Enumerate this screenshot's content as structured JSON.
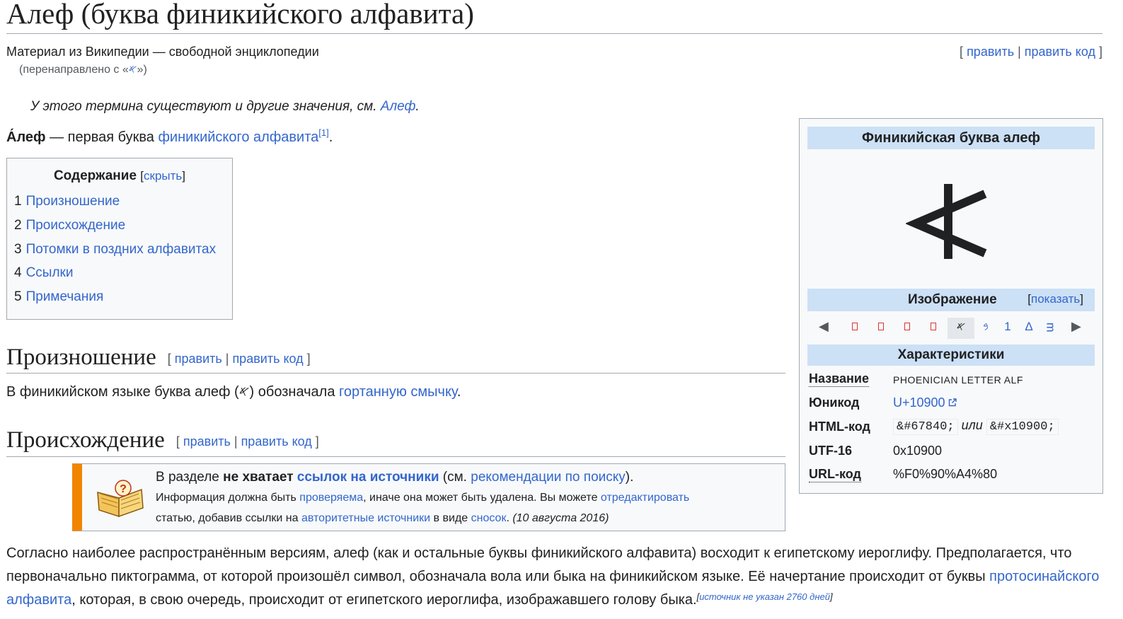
{
  "article": {
    "title": "Алеф (буква финикийского алфавита)",
    "site_sub": "Материал из Википедии — свободной энциклопедии",
    "redirect_prefix": "(перенаправлено с «",
    "redirect_glyph": "𐤀",
    "redirect_suffix": "»)",
    "edit_label": "править",
    "edit_source_label": "править код"
  },
  "hatnote": {
    "text": "У этого термина существуют и другие значения, см. ",
    "link": "Алеф",
    "end": "."
  },
  "lead": {
    "bold": "А́леф",
    "text": " — первая буква ",
    "link": "финикийского алфавита",
    "ref": "[1]",
    "end": "."
  },
  "toc": {
    "title": "Содержание",
    "toggle": "скрыть",
    "items": [
      {
        "num": "1",
        "label": "Произношение"
      },
      {
        "num": "2",
        "label": "Происхождение"
      },
      {
        "num": "3",
        "label": "Потомки в поздних алфавитах"
      },
      {
        "num": "4",
        "label": "Ссылки"
      },
      {
        "num": "5",
        "label": "Примечания"
      }
    ]
  },
  "sections": {
    "pronunciation": {
      "heading": "Произношение",
      "text_before": "В финикийском языке буква алеф (",
      "glyph": "𐤀",
      "text_middle": ") обозначала ",
      "link": "гортанную смычку",
      "end": "."
    },
    "origin": {
      "heading": "Происхождение"
    }
  },
  "ambox": {
    "l1_a": "В разделе ",
    "l1_bold": "не хватает ",
    "l1_link_bold": "ссылок на источники",
    "l1_b": " (см. ",
    "l1_link": "рекомендации по поиску",
    "l1_c": ").",
    "l2_a": "Информация должна быть ",
    "l2_link1": "проверяема",
    "l2_b": ", иначе она может быть удалена. Вы можете ",
    "l2_link2": "отредактировать",
    "l3_a": "статью, добавив ссылки на ",
    "l3_link1": "авторитетные источники",
    "l3_b": " в виде ",
    "l3_link2": "сносок",
    "l3_c": ". ",
    "l3_date": "(10 августа 2016)"
  },
  "bottom": {
    "text1": "Согласно наиболее распространённым версиям, алеф (как и остальные буквы финикийского алфавита) восходит к египетскому иероглифу. Предполагается, что первоначально пиктограмма, от которой произошёл символ, обозначала вола или быка на финикийском языке. Её начертание происходит от буквы ",
    "link": "протосинайского алфавита",
    "text2": ", которая, в свою очередь, происходит от египетского иероглифа, изображавшего голову быка.",
    "cite_open": "[",
    "cite_text": "источник не указан 2760 дней",
    "cite_close": "]"
  },
  "infobox": {
    "title": "Финикийская буква алеф",
    "image_label": "Изображение",
    "image_toggle": "показать",
    "nav": {
      "prev": "◀",
      "next": "▶",
      "glyphs": [
        "𐤀",
        "𐤁",
        "1",
        "Δ",
        "ᴟ"
      ]
    },
    "char_header": "Характеристики",
    "rows": {
      "name_label": "Название",
      "name_value": "PHOENICIAN LETTER ALF",
      "unicode_label": "Юникод",
      "unicode_value": "U+10900",
      "html_label": "HTML-код",
      "html_dec": "&#67840;",
      "html_or": "или",
      "html_hex": "&#x10900;",
      "utf16_label": "UTF-16",
      "utf16_value": "0x10900",
      "url_label": "URL-код",
      "url_value": "%F0%90%A4%80"
    }
  },
  "colors": {
    "link": "#3366cc",
    "header_bg": "#cce0f6",
    "ambox_stripe": "#f28500",
    "border": "#a2a9b1"
  }
}
